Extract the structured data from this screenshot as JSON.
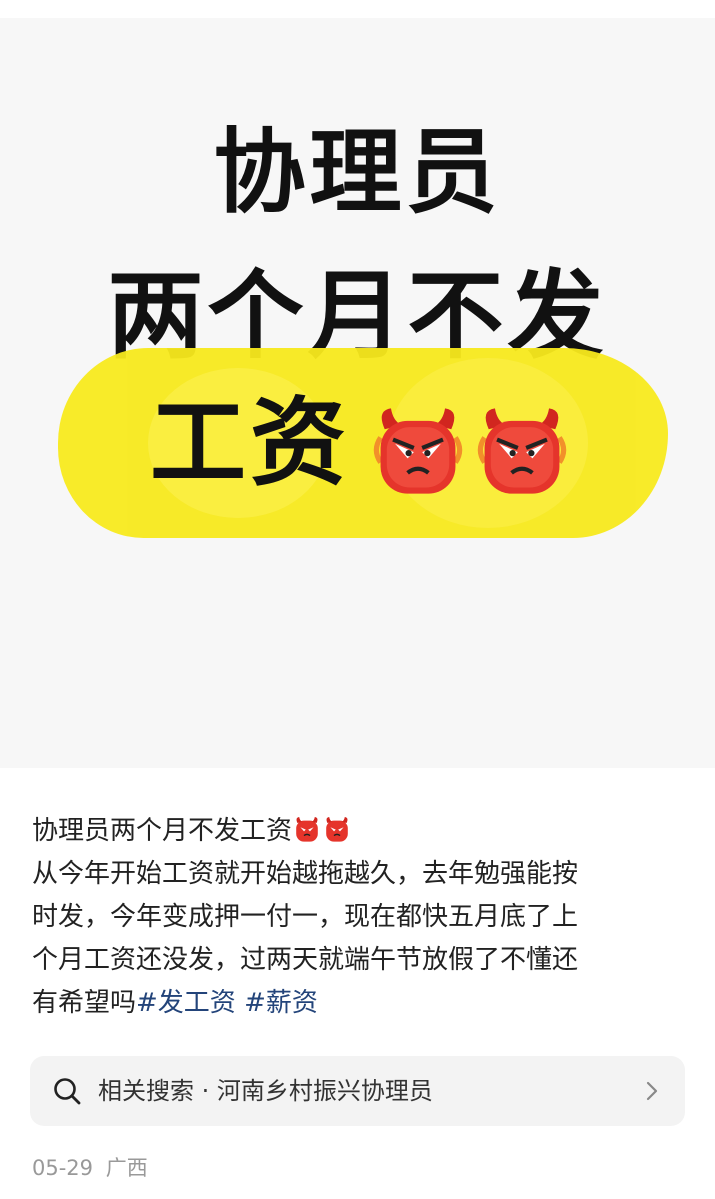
{
  "cover": {
    "line1": "协理员",
    "line2": "两个月不发",
    "line3": "工资",
    "emoji": "angry-devil-emoji",
    "highlight_color": "#f8ea1d"
  },
  "post": {
    "title": "协理员两个月不发工资",
    "body_line1": "从今年开始工资就开始越拖越久，去年勉强能按",
    "body_line2": "时发，今年变成押一付一，现在都快五月底了上",
    "body_line3": "个月工资还没发，过两天就端午节放假了不懂还",
    "body_line4": "有希望吗",
    "tags": [
      "#发工资",
      "#薪资"
    ],
    "tag_color": "#23447a"
  },
  "search": {
    "label": "相关搜索 · 河南乡村振兴协理员",
    "icon": "search-icon",
    "chevron": "chevron-right-icon"
  },
  "meta": {
    "date": "05-29",
    "location": "广西"
  }
}
